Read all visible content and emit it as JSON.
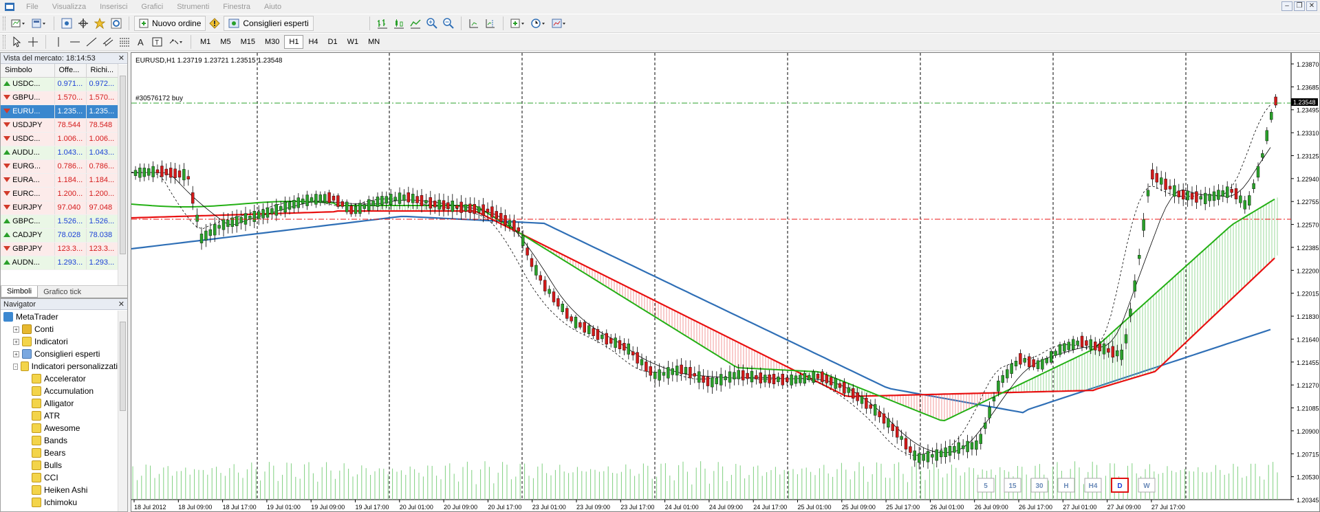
{
  "menu": [
    "File",
    "Visualizza",
    "Inserisci",
    "Grafici",
    "Strumenti",
    "Finestra",
    "Aiuto"
  ],
  "toolbar": {
    "new_order_label": "Nuovo ordine",
    "expert_advisors_label": "Consiglieri esperti",
    "timeframes": [
      "M1",
      "M5",
      "M15",
      "M30",
      "H1",
      "H4",
      "D1",
      "W1",
      "MN"
    ],
    "active_timeframe": "H1",
    "tools": [
      "cursor",
      "crosshair",
      "vertical-line",
      "horizontal-line",
      "trendline",
      "channel",
      "fibonacci",
      "text",
      "label",
      "arrows"
    ]
  },
  "market_watch": {
    "title": "Vista del mercato: 18:14:53",
    "columns": [
      "Simbolo",
      "Offe...",
      "Richi..."
    ],
    "rows": [
      {
        "symbol": "USDC...",
        "bid": "0.971...",
        "ask": "0.972...",
        "dir": "up",
        "color": "blue"
      },
      {
        "symbol": "GBPU...",
        "bid": "1.570...",
        "ask": "1.570...",
        "dir": "down",
        "color": "red"
      },
      {
        "symbol": "EURU...",
        "bid": "1.235...",
        "ask": "1.235...",
        "dir": "down",
        "color": "red",
        "selected": true
      },
      {
        "symbol": "USDJPY",
        "bid": "78.544",
        "ask": "78.548",
        "dir": "down",
        "color": "red"
      },
      {
        "symbol": "USDC...",
        "bid": "1.006...",
        "ask": "1.006...",
        "dir": "down",
        "color": "red"
      },
      {
        "symbol": "AUDU...",
        "bid": "1.043...",
        "ask": "1.043...",
        "dir": "up",
        "color": "blue"
      },
      {
        "symbol": "EURG...",
        "bid": "0.786...",
        "ask": "0.786...",
        "dir": "down",
        "color": "red"
      },
      {
        "symbol": "EURA...",
        "bid": "1.184...",
        "ask": "1.184...",
        "dir": "down",
        "color": "red"
      },
      {
        "symbol": "EURC...",
        "bid": "1.200...",
        "ask": "1.200...",
        "dir": "down",
        "color": "red"
      },
      {
        "symbol": "EURJPY",
        "bid": "97.040",
        "ask": "97.048",
        "dir": "down",
        "color": "red"
      },
      {
        "symbol": "GBPC...",
        "bid": "1.526...",
        "ask": "1.526...",
        "dir": "up",
        "color": "blue"
      },
      {
        "symbol": "CADJPY",
        "bid": "78.028",
        "ask": "78.038",
        "dir": "up",
        "color": "blue"
      },
      {
        "symbol": "GBPJPY",
        "bid": "123.3...",
        "ask": "123.3...",
        "dir": "down",
        "color": "red"
      },
      {
        "symbol": "AUDN...",
        "bid": "1.293...",
        "ask": "1.293...",
        "dir": "up",
        "color": "blue"
      }
    ],
    "tabs": [
      "Simboli",
      "Grafico tick"
    ],
    "active_tab": "Simboli"
  },
  "navigator": {
    "title": "Navigator",
    "items": [
      {
        "label": "MetaTrader",
        "level": 0,
        "icon": "mt",
        "exp": ""
      },
      {
        "label": "Conti",
        "level": 1,
        "icon": "folder",
        "exp": "+"
      },
      {
        "label": "Indicatori",
        "level": 1,
        "icon": "ind",
        "exp": "+"
      },
      {
        "label": "Consiglieri esperti",
        "level": 1,
        "icon": "ea",
        "exp": "+"
      },
      {
        "label": "Indicatori personalizzati",
        "level": 1,
        "icon": "ind",
        "exp": "-"
      },
      {
        "label": "Accelerator",
        "level": 2,
        "icon": "ind",
        "exp": ""
      },
      {
        "label": "Accumulation",
        "level": 2,
        "icon": "ind",
        "exp": ""
      },
      {
        "label": "Alligator",
        "level": 2,
        "icon": "ind",
        "exp": ""
      },
      {
        "label": "ATR",
        "level": 2,
        "icon": "ind",
        "exp": ""
      },
      {
        "label": "Awesome",
        "level": 2,
        "icon": "ind",
        "exp": ""
      },
      {
        "label": "Bands",
        "level": 2,
        "icon": "ind",
        "exp": ""
      },
      {
        "label": "Bears",
        "level": 2,
        "icon": "ind",
        "exp": ""
      },
      {
        "label": "Bulls",
        "level": 2,
        "icon": "ind",
        "exp": ""
      },
      {
        "label": "CCI",
        "level": 2,
        "icon": "ind",
        "exp": ""
      },
      {
        "label": "Heiken Ashi",
        "level": 2,
        "icon": "ind",
        "exp": ""
      },
      {
        "label": "Ichimoku",
        "level": 2,
        "icon": "ind",
        "exp": ""
      }
    ]
  },
  "chart": {
    "info": "EURUSD,H1  1.23719 1.23721 1.23515 1.23548",
    "order_label": "#30576172 buy",
    "current_price": "1.23548",
    "y_labels": [
      "1.23870",
      "1.23685",
      "1.23495",
      "1.23310",
      "1.23125",
      "1.22940",
      "1.22755",
      "1.22570",
      "1.22385",
      "1.22200",
      "1.22015",
      "1.21830",
      "1.21640",
      "1.21455",
      "1.21270",
      "1.21085",
      "1.20900",
      "1.20715",
      "1.20530",
      "1.20345"
    ],
    "x_labels": [
      "18 Jul 2012",
      "18 Jul 09:00",
      "18 Jul 17:00",
      "19 Jul 01:00",
      "19 Jul 09:00",
      "19 Jul 17:00",
      "20 Jul 01:00",
      "20 Jul 09:00",
      "20 Jul 17:00",
      "23 Jul 01:00",
      "23 Jul 09:00",
      "23 Jul 17:00",
      "24 Jul 01:00",
      "24 Jul 09:00",
      "24 Jul 17:00",
      "25 Jul 01:00",
      "25 Jul 09:00",
      "25 Jul 17:00",
      "26 Jul 01:00",
      "26 Jul 09:00",
      "26 Jul 17:00",
      "27 Jul 01:00",
      "27 Jul 09:00",
      "27 Jul 17:00"
    ],
    "period_buttons": [
      "5",
      "15",
      "30",
      "H",
      "H4",
      "D",
      "W"
    ],
    "colors": {
      "bull": "#2aa02a",
      "bear": "#d21a1a",
      "ma_fast_green": "#23b014",
      "ma_red": "#e81010",
      "ma_blue": "#2f6fb6",
      "volume": "#7fd07f",
      "order_line": "#2aa02a",
      "stop_line": "#e81010"
    }
  }
}
